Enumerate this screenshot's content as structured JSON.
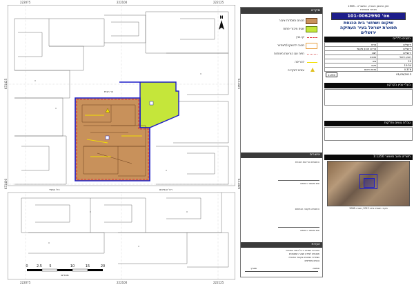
{
  "map": {
    "coords_top": [
      "222075",
      "222100",
      "222125"
    ],
    "coords_bottom": [
      "222075",
      "222100",
      "222125"
    ],
    "coords_left": [
      "631425",
      "631400"
    ],
    "coords_right": [
      "631425",
      "631400"
    ],
    "north_label": "N",
    "street_labels": [
      "הר הבית",
      "רח' המגיד",
      "רח' הנביאים"
    ],
    "scale_ticks": [
      "0",
      "2.5",
      "5",
      "10",
      "15",
      "20"
    ],
    "scale_unit": "מטרים",
    "colors": {
      "yellow_green": "#c5e63a",
      "brown": "#c8915b",
      "blue_outline": "#1d1dc8",
      "red_dash": "#e0303a",
      "yellow_line": "#f2e000"
    }
  },
  "legend": {
    "title": "מקרא",
    "items": [
      {
        "label": "מבנים ומוסדות ציבור",
        "color": "#c8915b"
      },
      {
        "label": "שטח ציבורי פתוח",
        "color": "#c5e63a"
      },
      {
        "label": "קו בנין",
        "color": "#e0303a"
      },
      {
        "label": "מבנה להשקה/לשחזור",
        "color": "#f5e090"
      },
      {
        "label": "חזית עם הוראות מיוחדות",
        "color": "#d65050"
      },
      {
        "label": "להריסה",
        "color": "#f2e000"
      },
      {
        "label": "עצים לעקירה",
        "color": "#e0c020"
      }
    ],
    "sub_head_1": "אישורים",
    "sub_text_1": "התאמת הוראות תוכנית",
    "sub_text_2": "שם ומספר החותם",
    "sub_text_3": "התאמה מקצה הנתונים",
    "sub_text_4": "שם ומספר החותם",
    "notes_head": "הערות",
    "note_lines": [
      "הצהרת המגיש כי כל נתוני התכנית",
      "תואמים למידע ושאר המסמכים",
      "ושמירת הנתונים בקבצי התכנית",
      "נכונים ומחייבים"
    ],
    "sig_labels": [
      "חתימה",
      "תאריך"
    ]
  },
  "plan": {
    "header_top": "חוק התכנון והבניה, התשכ\"ה - 1965",
    "header_sub": "תכנית מפורטת",
    "plan_no": "מס' 101-0062950",
    "title_1": "שיקום ושחזור בית הכנסת",
    "title_2": "תפארת ישראל בעיר העתיקה",
    "title_3": "ירושלים",
    "section_1_head": "נתונים כלליים",
    "section_2_head": "בעלי עניין בקרקע",
    "section_3_head": "טבלת גושים וחלקות",
    "section_4_head": "תשריט מצב מאושר 1:1250",
    "info_rows": [
      [
        "ירושלים",
        "מחוז"
      ],
      [
        "ירושלים",
        "מרחב תכנון מקומי"
      ],
      [
        "ירושלים",
        "ישוב"
      ],
      [
        "רובע היהודי",
        "שכונה"
      ],
      [
        "20",
        "גוש"
      ],
      [
        "15:34",
        "שעה"
      ],
      [
        "0.376",
        "שטח בדונם"
      ]
    ],
    "scale_box": "1:250",
    "date": "01/09/2013",
    "bottom_note": "מקור: תשתית מידע 2013, תשריט 2008"
  }
}
